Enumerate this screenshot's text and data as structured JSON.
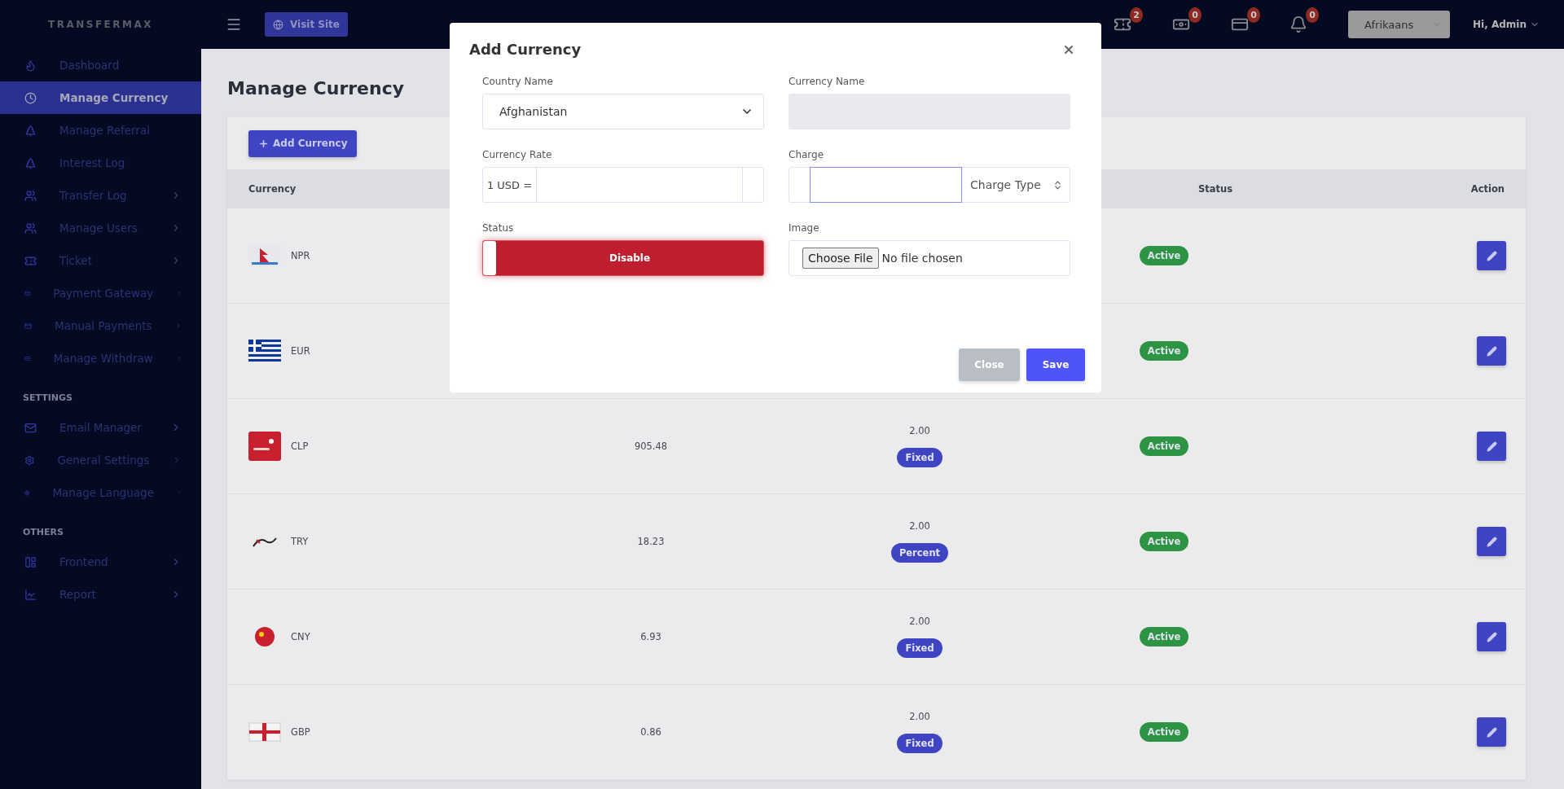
{
  "sidebar": {
    "brand": "TRANSFERMAX",
    "groups": [
      {
        "items": [
          {
            "label": "Dashboard",
            "selected": false,
            "submenu": false
          },
          {
            "label": "Manage Currency",
            "selected": true,
            "submenu": false
          },
          {
            "label": "Manage Referral",
            "selected": false,
            "submenu": false
          },
          {
            "label": "Interest Log",
            "selected": false,
            "submenu": false
          },
          {
            "label": "Transfer Log",
            "selected": false,
            "submenu": true
          },
          {
            "label": "Manage Users",
            "selected": false,
            "submenu": true
          },
          {
            "label": "Ticket",
            "selected": false,
            "submenu": true
          },
          {
            "label": "Payment Gateway",
            "selected": false,
            "submenu": true
          },
          {
            "label": "Manual Payments",
            "selected": false,
            "submenu": true
          },
          {
            "label": "Manage Withdraw",
            "selected": false,
            "submenu": true
          }
        ]
      },
      {
        "heading": "SETTINGS",
        "items": [
          {
            "label": "Email Manager",
            "selected": false,
            "submenu": true
          },
          {
            "label": "General Settings",
            "selected": false,
            "submenu": true
          },
          {
            "label": "Manage Language",
            "selected": false,
            "submenu": true
          }
        ]
      },
      {
        "heading": "OTHERS",
        "items": [
          {
            "label": "Frontend",
            "selected": false,
            "submenu": true
          },
          {
            "label": "Report",
            "selected": false,
            "submenu": true
          }
        ]
      }
    ]
  },
  "topbar": {
    "visit_site": "Visit Site",
    "notifications": [
      {
        "count": "2"
      },
      {
        "count": "0"
      },
      {
        "count": "0"
      },
      {
        "count": "0"
      }
    ],
    "language": "Afrikaans",
    "user": "Hi, Admin"
  },
  "page": {
    "title": "Manage Currency",
    "add_button": "Add Currency",
    "table": {
      "columns": [
        "Currency",
        "Status",
        "Action"
      ],
      "rows": [
        {
          "code": "NPR",
          "status": "Active"
        },
        {
          "code": "EUR",
          "status": "Active"
        },
        {
          "code": "CLP",
          "rate": "905.48",
          "charge": "2.00",
          "charge_type": "Fixed",
          "status": "Active"
        },
        {
          "code": "TRY",
          "rate": "18.23",
          "charge": "2.00",
          "charge_type": "Percent",
          "status": "Active"
        },
        {
          "code": "CNY",
          "rate": "6.93",
          "charge": "2.00",
          "charge_type": "Fixed",
          "status": "Active"
        },
        {
          "code": "GBP",
          "rate": "0.86",
          "charge": "2.00",
          "charge_type": "Fixed",
          "status": "Active"
        }
      ]
    }
  },
  "modal": {
    "title": "Add Currency",
    "country": {
      "label": "Country Name",
      "value": "Afghanistan"
    },
    "currency_name": {
      "label": "Currency Name"
    },
    "rate": {
      "label": "Currency Rate",
      "prefix": "1 USD ="
    },
    "charge": {
      "label": "Charge",
      "type_placeholder": "Charge Type"
    },
    "status": {
      "label": "Status",
      "on": false,
      "text": "Disable"
    },
    "image": {
      "label": "Image",
      "button": "Choose File",
      "file": "No file chosen"
    },
    "buttons": {
      "close": "Close",
      "save": "Save"
    }
  }
}
